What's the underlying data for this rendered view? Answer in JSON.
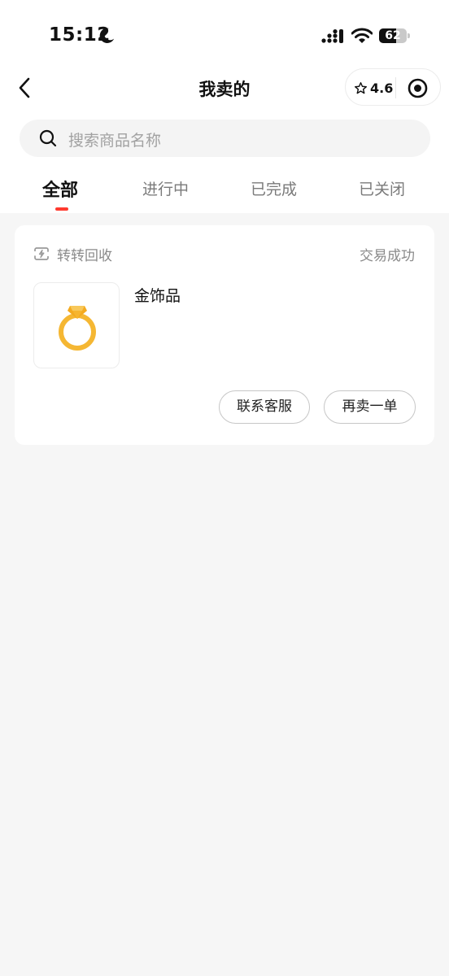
{
  "status_bar": {
    "time": "15:12",
    "battery_level": "62",
    "battery_fraction": 0.62
  },
  "nav": {
    "title": "我卖的",
    "rating": "4.6"
  },
  "search": {
    "placeholder": "搜索商品名称"
  },
  "tabs": [
    {
      "label": "全部",
      "active": true
    },
    {
      "label": "进行中",
      "active": false
    },
    {
      "label": "已完成",
      "active": false
    },
    {
      "label": "已关闭",
      "active": false
    }
  ],
  "orders": [
    {
      "channel": "转转回收",
      "status": "交易成功",
      "product_name": "金饰品",
      "buttons": {
        "contact": "联系客服",
        "resell": "再卖一单"
      }
    }
  ],
  "colors": {
    "accent": "#ff3a2f",
    "ring_gold": "#f5b733",
    "page_bg": "#f6f6f6"
  },
  "icons": [
    "moon-icon",
    "cellular-signal-icon",
    "wifi-icon",
    "battery-icon",
    "back-arrow-icon",
    "star-icon",
    "target-icon",
    "search-icon",
    "recycle-icon",
    "gold-ring-icon"
  ]
}
